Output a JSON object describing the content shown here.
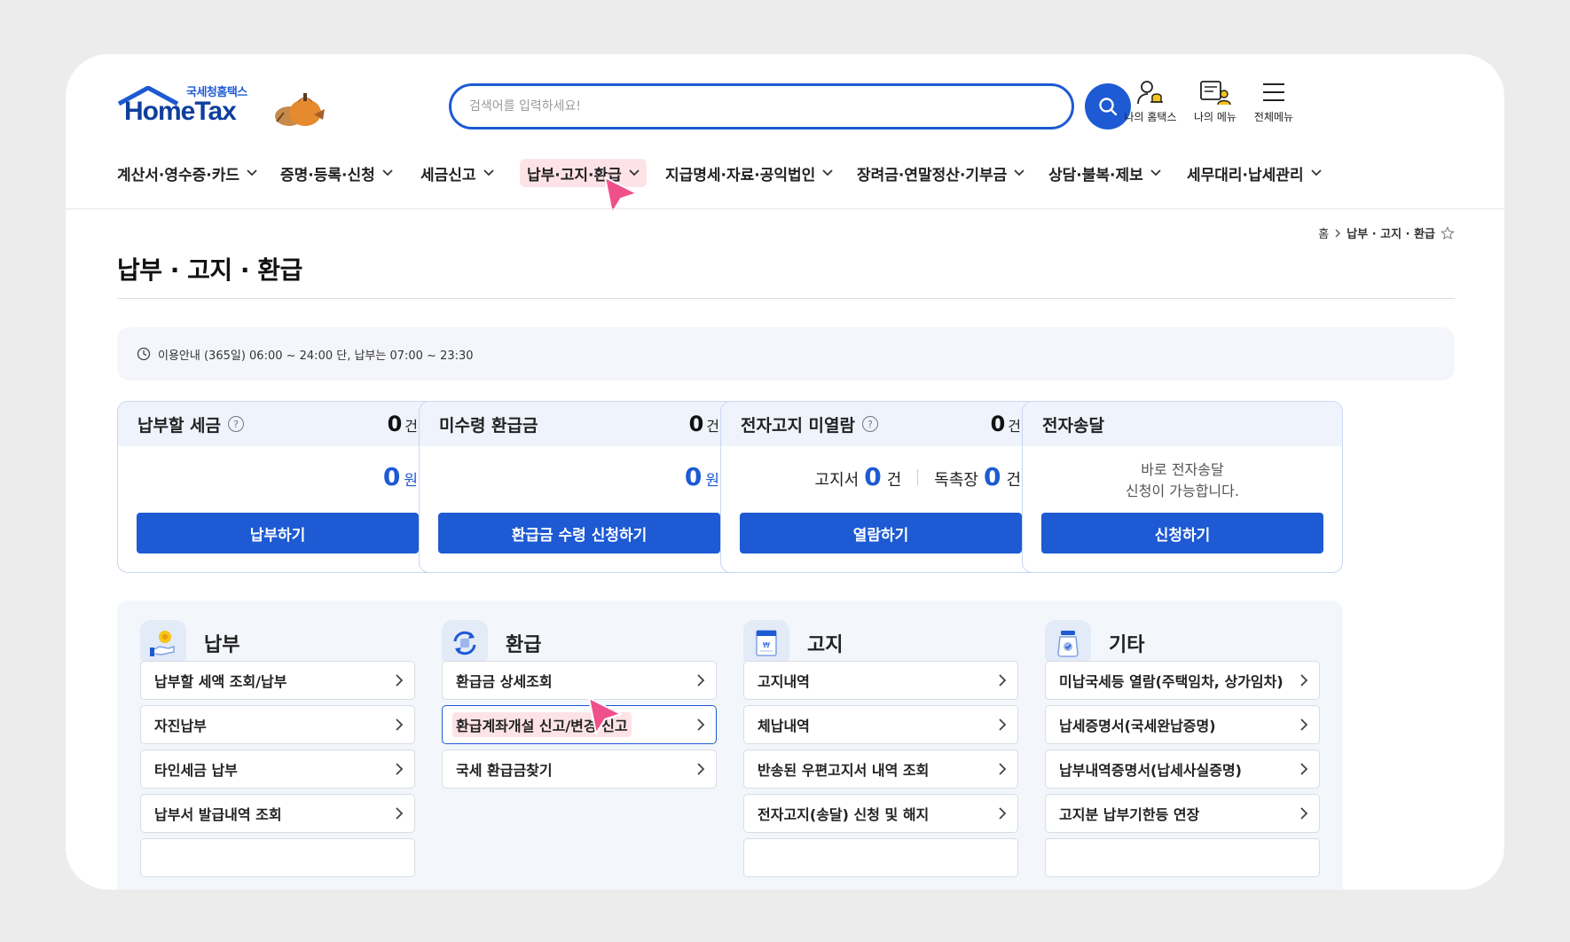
{
  "header": {
    "logo_sub": "국세청홈택스",
    "logo_main": "HomeTax",
    "search_placeholder": "검색어를 입력하세요!",
    "util": [
      "나의 홈택스",
      "나의 메뉴",
      "전체메뉴"
    ]
  },
  "gnb": [
    "계산서·영수증·카드",
    "증명·등록·신청",
    "세금신고",
    "납부·고지·환급",
    "지급명세·자료·공익법인",
    "장려금·연말정산·기부금",
    "상담·불복·제보",
    "세무대리·납세관리"
  ],
  "gnb_active_index": 3,
  "breadcrumb": {
    "home": "홈",
    "current": "납부 · 고지 · 환급"
  },
  "page_title": "납부 · 고지 · 환급",
  "notice": "이용안내 (365일) 06:00 ~ 24:00 단, 납부는 07:00 ~ 23:30",
  "cards": [
    {
      "title": "납부할 세금",
      "count": "0",
      "count_unit": "건",
      "amount": "0",
      "amount_unit": "원",
      "button": "납부하기"
    },
    {
      "title": "미수령 환급금",
      "count": "0",
      "count_unit": "건",
      "amount": "0",
      "amount_unit": "원",
      "button": "환급금 수령 신청하기"
    },
    {
      "title": "전자고지 미열람",
      "count": "0",
      "count_unit": "건",
      "notice_label": "고지서",
      "notice_count": "0",
      "notice_unit": "건",
      "ledger_label": "독촉장",
      "ledger_count": "0",
      "ledger_unit": "건",
      "button": "열람하기"
    },
    {
      "title": "전자송달",
      "desc_line1": "바로 전자송달",
      "desc_line2": "신청이 가능합니다.",
      "button": "신청하기"
    }
  ],
  "sections": [
    {
      "title": "납부",
      "links": [
        "납부할 세액 조회/납부",
        "자진납부",
        "타인세금 납부",
        "납부서 발급내역 조회"
      ]
    },
    {
      "title": "환급",
      "links": [
        "환급금 상세조회",
        "환급계좌개설 신고/변경 신고",
        "국세 환급금찾기"
      ]
    },
    {
      "title": "고지",
      "links": [
        "고지내역",
        "체납내역",
        "반송된 우편고지서 내역 조회",
        "전자고지(송달) 신청 및 해지"
      ]
    },
    {
      "title": "기타",
      "links": [
        "미납국세등 열람(주택임차, 상가임차)",
        "납세증명서(국세완납증명)",
        "납부내역증명서(납세사실증명)",
        "고지분 납부기한등 연장"
      ]
    }
  ],
  "active_link": "환급계좌개설 신고/변경 신고",
  "colors": {
    "primary": "#1d5ad3",
    "highlight": "#fde3e8",
    "cursor": "#f0508a"
  }
}
